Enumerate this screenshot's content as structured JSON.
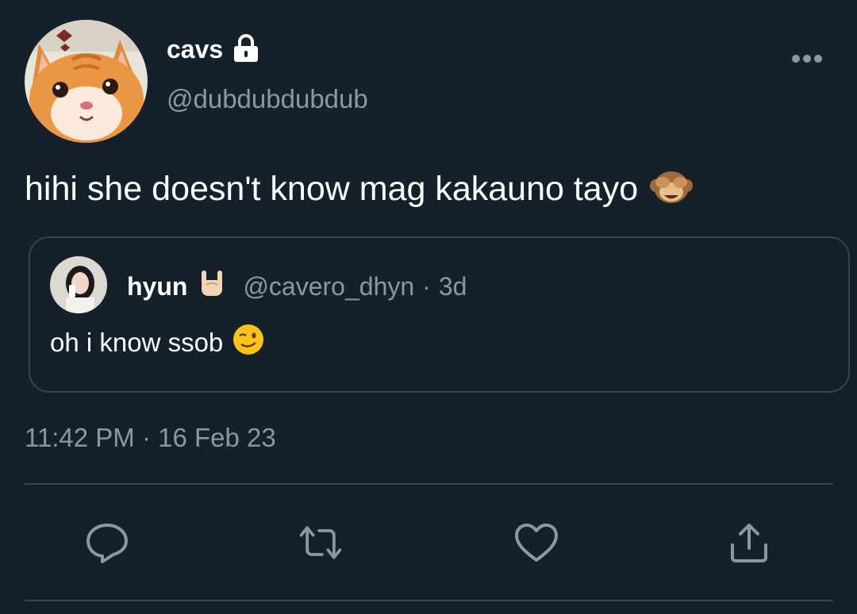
{
  "tweet": {
    "display_name": "cavs",
    "handle": "@dubdubdubdub",
    "text": "hihi she doesn't know mag kakauno tayo",
    "text_emoji": "see-no-evil-monkey",
    "timestamp": "11:42 PM · 16 Feb 23",
    "protected": true
  },
  "quoted": {
    "display_name": "hyun",
    "name_emoji": "sign-of-the-horns",
    "handle": "@cavero_dhyn",
    "separator": "·",
    "age": "3d",
    "text": "oh i know ssob",
    "text_emoji": "winking-face"
  },
  "actions": [
    "reply-icon",
    "retweet-icon",
    "like-icon",
    "share-icon"
  ],
  "colors": {
    "background": "#15202b",
    "primary_text": "#ffffff",
    "secondary_text": "#8899a6",
    "border": "#38444d"
  }
}
